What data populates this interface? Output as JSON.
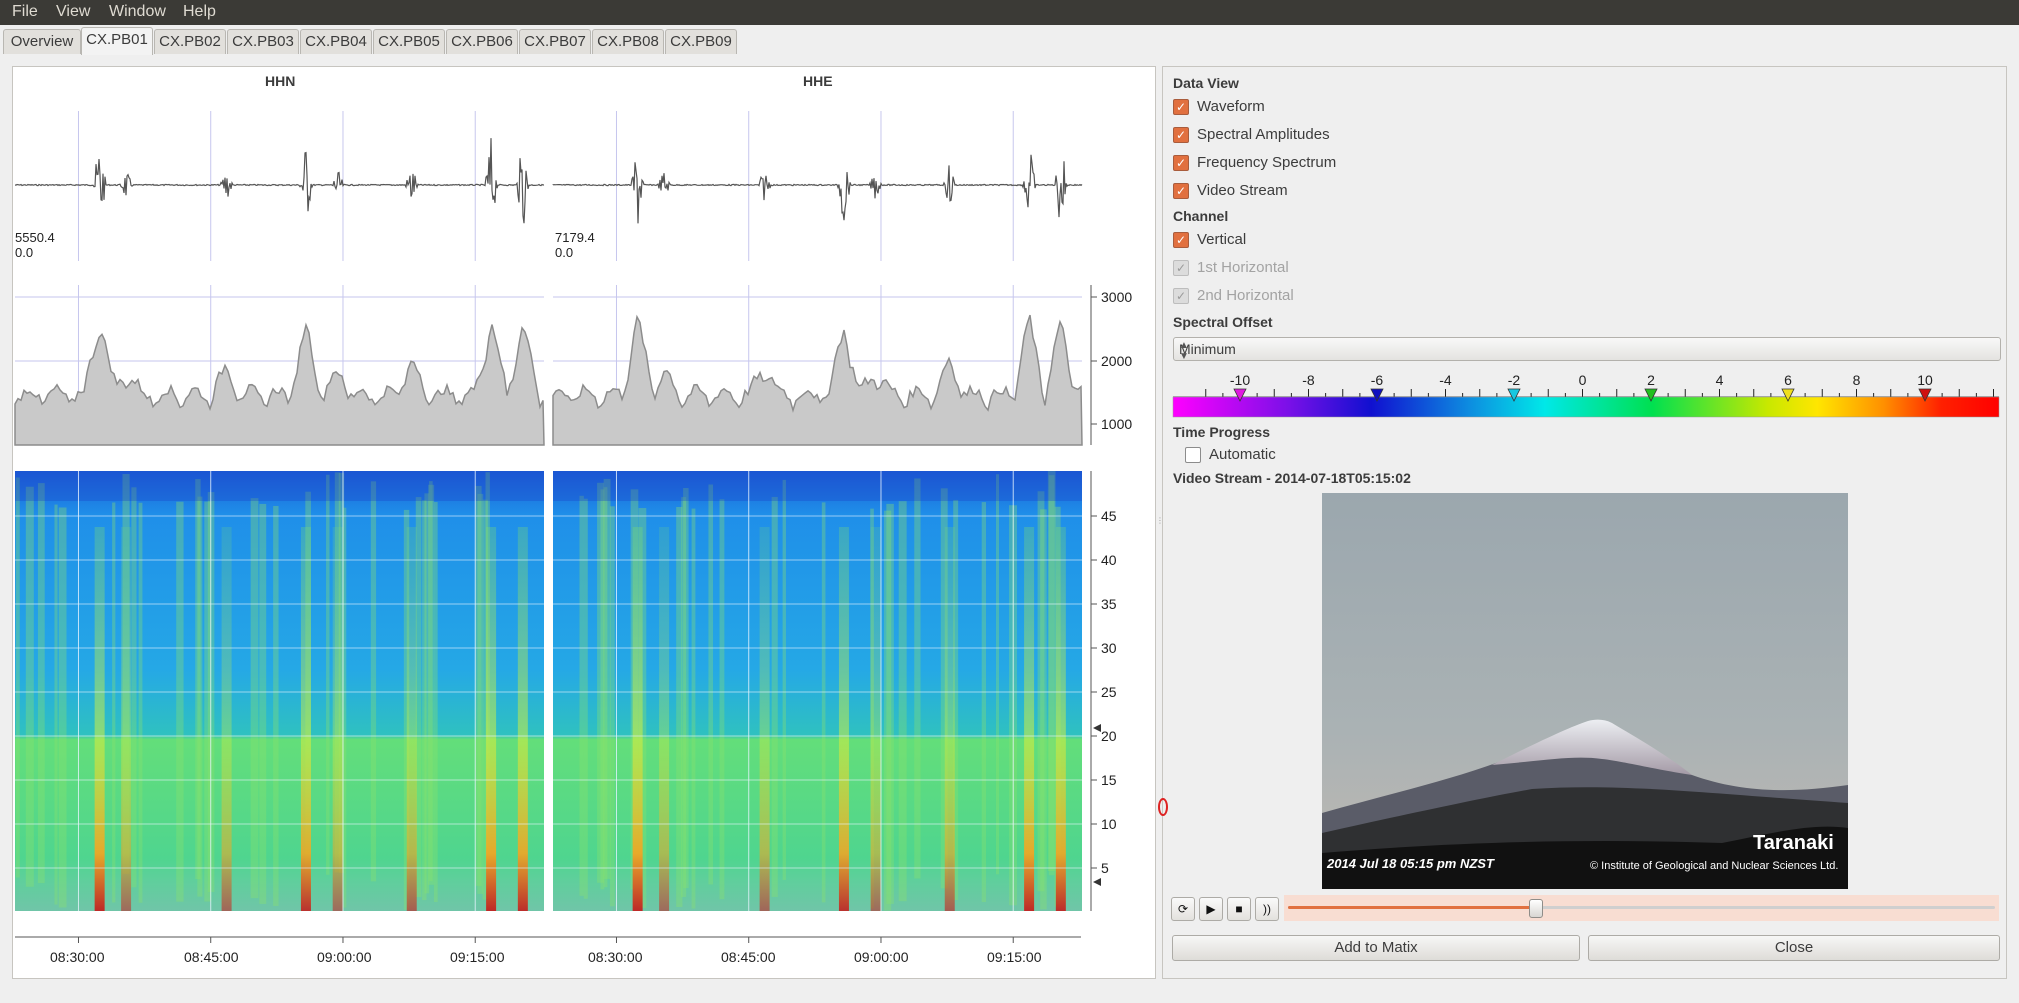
{
  "menu": [
    "File",
    "View",
    "Window",
    "Help"
  ],
  "tabs": [
    "Overview",
    "CX.PB01",
    "CX.PB02",
    "CX.PB03",
    "CX.PB04",
    "CX.PB05",
    "CX.PB06",
    "CX.PB07",
    "CX.PB08",
    "CX.PB09"
  ],
  "active_tab": "CX.PB01",
  "channels": [
    {
      "name": "HHN",
      "max": "5550.4",
      "min": "0.0"
    },
    {
      "name": "HHE",
      "max": "7179.4",
      "min": "0.0"
    }
  ],
  "amplitude_axis": [
    "3000",
    "2000",
    "1000"
  ],
  "freq_axis": [
    "45",
    "40",
    "35",
    "30",
    "25",
    "20",
    "15",
    "10",
    "5"
  ],
  "time_axis": [
    "08:30:00",
    "08:45:00",
    "09:00:00",
    "09:15:00"
  ],
  "colors": {
    "accent": "#e1703f",
    "waveform": "#555555",
    "amplitude_fill": "#c8c8c8"
  },
  "data_view": {
    "title": "Data View",
    "items": [
      {
        "label": "Waveform",
        "checked": true
      },
      {
        "label": "Spectral Amplitudes",
        "checked": true
      },
      {
        "label": "Frequency Spectrum",
        "checked": true
      },
      {
        "label": "Video Stream",
        "checked": true
      }
    ]
  },
  "channel_section": {
    "title": "Channel",
    "items": [
      {
        "label": "Vertical",
        "checked": true,
        "enabled": true
      },
      {
        "label": "1st Horizontal",
        "checked": true,
        "enabled": false
      },
      {
        "label": "2nd Horizontal",
        "checked": true,
        "enabled": false
      }
    ]
  },
  "spectral_offset": {
    "title": "Spectral Offset",
    "value": "Minimum",
    "scale_labels": [
      "-10",
      "-8",
      "-6",
      "-4",
      "-2",
      "0",
      "2",
      "4",
      "6",
      "8",
      "10"
    ]
  },
  "time_progress": {
    "title": "Time Progress",
    "automatic_label": "Automatic",
    "automatic_checked": false
  },
  "video": {
    "title": "Video Stream - 2014-07-18T05:15:02",
    "caption_time": "2014 Jul 18 05:15 pm NZST",
    "caption_place": "Taranaki",
    "caption_credit": "© Institute of Geological and Nuclear Sciences Ltd.",
    "progress": 0.35
  },
  "buttons": {
    "add": "Add to Matix",
    "close": "Close"
  },
  "player_icons": [
    "refresh-icon",
    "play-icon",
    "stop-icon",
    "feed-icon"
  ]
}
